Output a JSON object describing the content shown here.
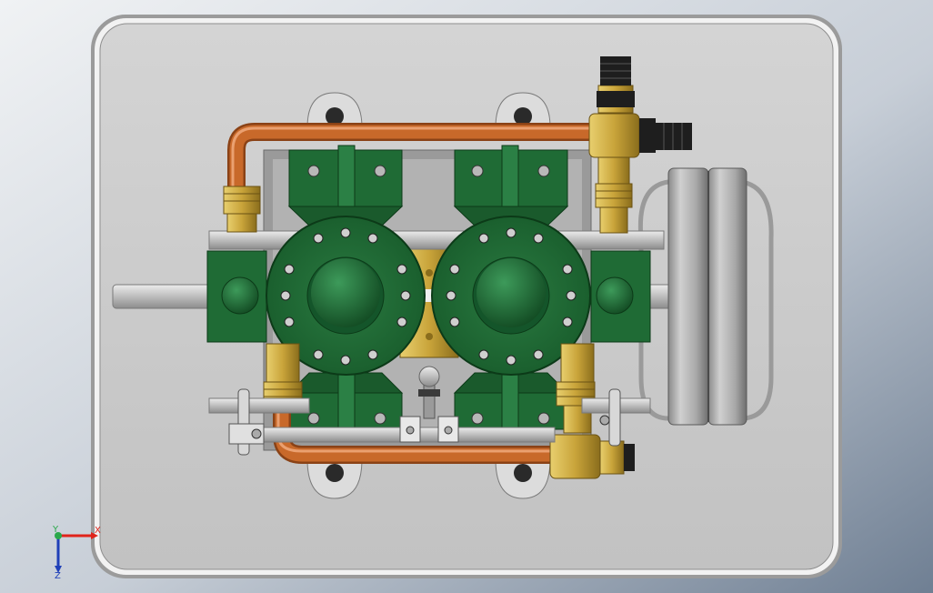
{
  "viewport": {
    "background_top": "#e9ecef",
    "background_bottom": "#7f8da0"
  },
  "model": {
    "plate_color": "#c9c9c9",
    "pipe_color": "#c8692a",
    "brass_color": "#c9a43a",
    "body_color": "#1f6b35",
    "steel_color": "#b8b8b8",
    "flywheel_color": "#9a9a9a",
    "nut_color": "#1e1e1e"
  },
  "triad": {
    "x_label": "X",
    "y_label": "Y",
    "z_label": "Z",
    "x_color": "#e0241b",
    "y_color": "#2aa84a",
    "z_color": "#1f3fb8"
  }
}
